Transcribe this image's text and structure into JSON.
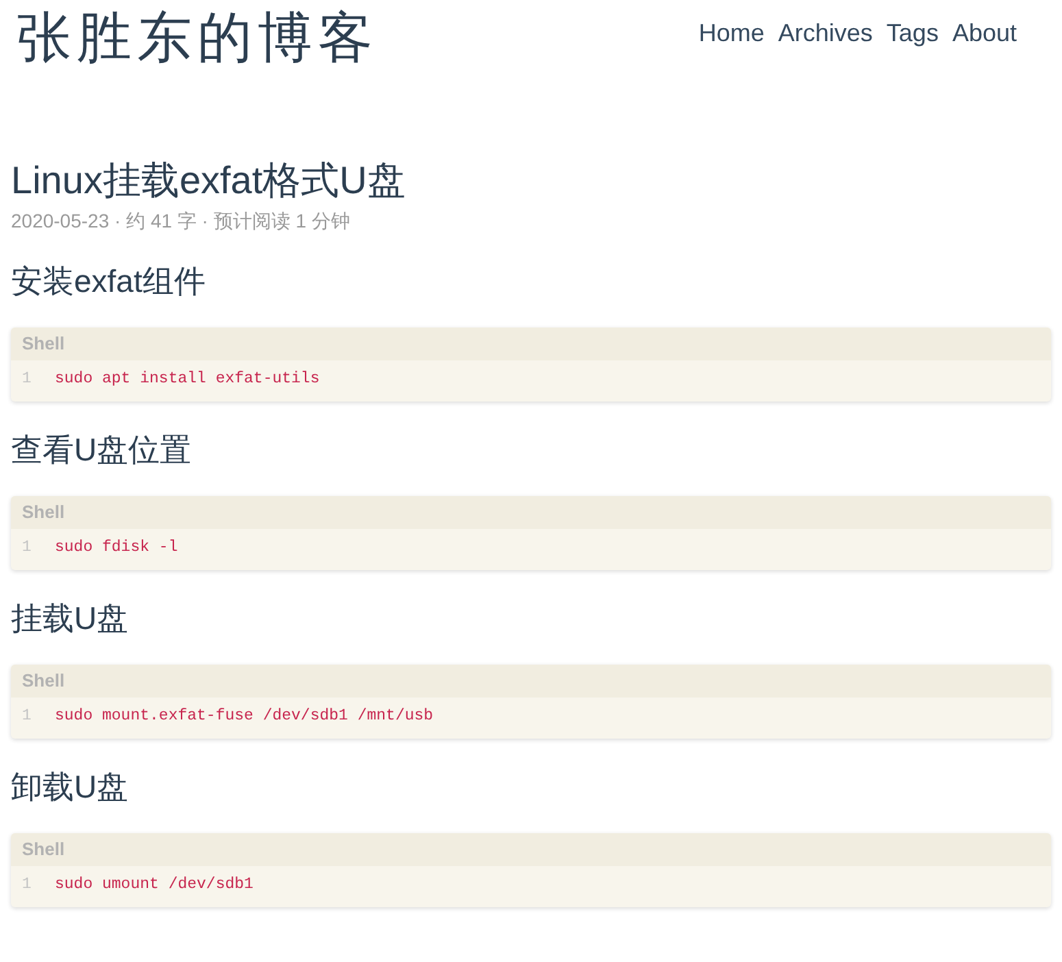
{
  "site_title": "张胜东的博客",
  "nav": [
    "Home",
    "Archives",
    "Tags",
    "About"
  ],
  "post": {
    "title": "Linux挂载exfat格式U盘",
    "meta": "2020-05-23 · 约 41 字 · 预计阅读 1 分钟"
  },
  "sections": [
    {
      "heading": "安装exfat组件",
      "code": {
        "language": "Shell",
        "lines": [
          {
            "number": "1",
            "text": "sudo apt install exfat-utils"
          }
        ]
      }
    },
    {
      "heading": "查看U盘位置",
      "code": {
        "language": "Shell",
        "lines": [
          {
            "number": "1",
            "text": "sudo fdisk -l"
          }
        ]
      }
    },
    {
      "heading": "挂载U盘",
      "code": {
        "language": "Shell",
        "lines": [
          {
            "number": "1",
            "text": "sudo mount.exfat-fuse /dev/sdb1 /mnt/usb"
          }
        ]
      }
    },
    {
      "heading": "卸载U盘",
      "code": {
        "language": "Shell",
        "lines": [
          {
            "number": "1",
            "text": "sudo umount /dev/sdb1"
          }
        ]
      }
    }
  ]
}
